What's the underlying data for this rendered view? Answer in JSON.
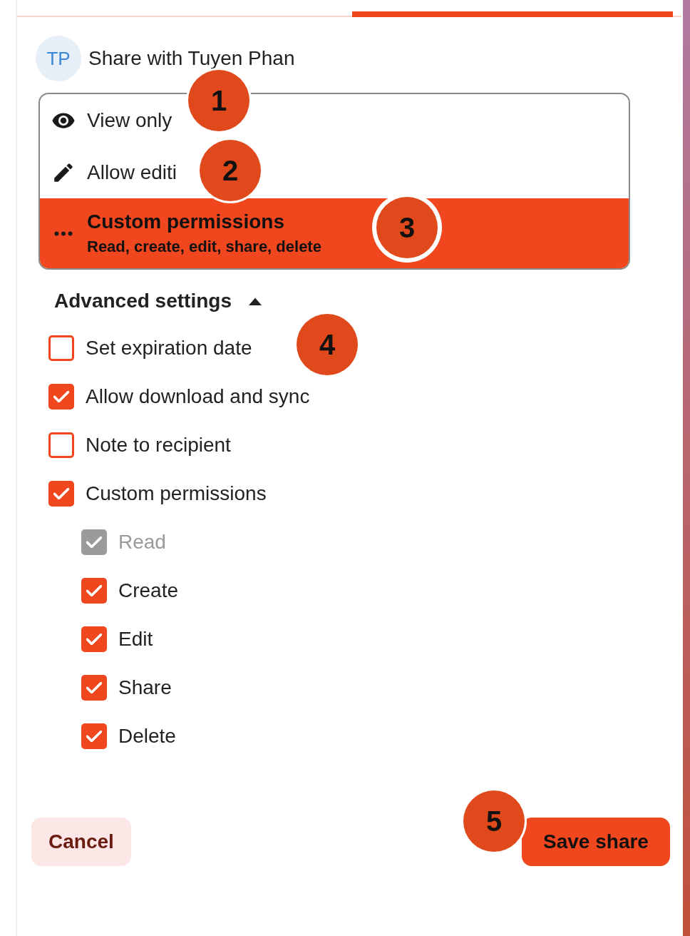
{
  "header": {
    "avatar": "TP",
    "title": "Share with Tuyen Phan"
  },
  "permissions": [
    {
      "kind": "view",
      "label": "View only",
      "selected": false
    },
    {
      "kind": "edit",
      "label": "Allow editi",
      "selected": false
    },
    {
      "kind": "custom",
      "label": "Custom permissions",
      "description": "Read, create, edit, share, delete",
      "selected": true
    }
  ],
  "advanced": {
    "label": "Advanced settings",
    "expanded": true
  },
  "options": [
    {
      "label": "Set expiration date",
      "checked": false,
      "disabled": false
    },
    {
      "label": "Allow download and sync",
      "checked": true,
      "disabled": false
    },
    {
      "label": "Note to recipient",
      "checked": false,
      "disabled": false
    },
    {
      "label": "Custom permissions",
      "checked": true,
      "disabled": false,
      "children": [
        {
          "label": "Read",
          "checked": true,
          "disabled": true
        },
        {
          "label": "Create",
          "checked": true,
          "disabled": false
        },
        {
          "label": "Edit",
          "checked": true,
          "disabled": false
        },
        {
          "label": "Share",
          "checked": true,
          "disabled": false
        },
        {
          "label": "Delete",
          "checked": true,
          "disabled": false
        }
      ]
    }
  ],
  "buttons": [
    {
      "label": "Cancel",
      "kind": "secondary"
    },
    {
      "label": "Save share",
      "kind": "primary"
    }
  ],
  "callouts": [
    "1",
    "2",
    "3",
    "4",
    "5"
  ]
}
